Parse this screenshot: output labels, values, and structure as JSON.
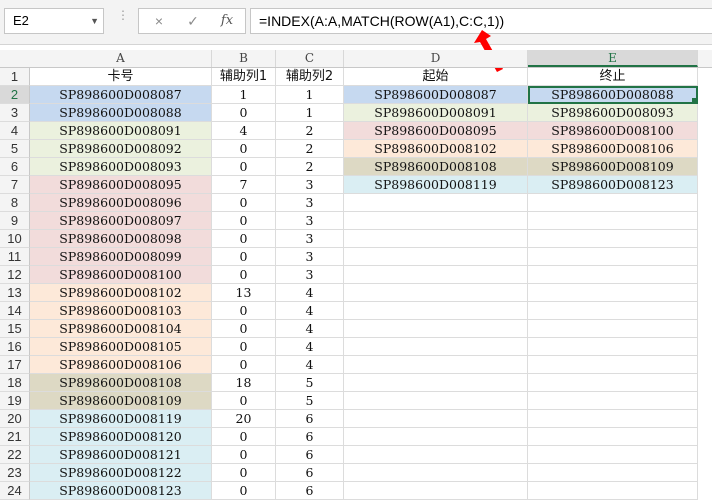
{
  "formula_bar": {
    "name_box": "E2",
    "cancel_icon": "×",
    "confirm_icon": "✓",
    "fx_label": "fx",
    "formula": "=INDEX(A:A,MATCH(ROW(A1),C:C,1))"
  },
  "colors": {
    "blue": "#c6d9f0",
    "green": "#ebf1de",
    "pink": "#f2dcdb",
    "peach": "#fde9d9",
    "tan": "#ddd9c4",
    "cyan": "#daeef3",
    "arrow": "#ff0000",
    "select": "#217346"
  },
  "columns": [
    "A",
    "B",
    "C",
    "D",
    "E"
  ],
  "selected_cell": "E2",
  "rows": [
    {
      "n": "1",
      "a": "卡号",
      "b": "辅助列1",
      "c": "辅助列2",
      "d": "起始",
      "e": "终止",
      "fill": "",
      "fill_de": ""
    },
    {
      "n": "2",
      "a": "SP898600D008087",
      "b": "1",
      "c": "1",
      "d": "SP898600D008087",
      "e": "SP898600D008088",
      "fill": "blue",
      "fill_de": "blue"
    },
    {
      "n": "3",
      "a": "SP898600D008088",
      "b": "0",
      "c": "1",
      "d": "SP898600D008091",
      "e": "SP898600D008093",
      "fill": "blue",
      "fill_de": "green"
    },
    {
      "n": "4",
      "a": "SP898600D008091",
      "b": "4",
      "c": "2",
      "d": "SP898600D008095",
      "e": "SP898600D008100",
      "fill": "green",
      "fill_de": "pink"
    },
    {
      "n": "5",
      "a": "SP898600D008092",
      "b": "0",
      "c": "2",
      "d": "SP898600D008102",
      "e": "SP898600D008106",
      "fill": "green",
      "fill_de": "peach"
    },
    {
      "n": "6",
      "a": "SP898600D008093",
      "b": "0",
      "c": "2",
      "d": "SP898600D008108",
      "e": "SP898600D008109",
      "fill": "green",
      "fill_de": "tan"
    },
    {
      "n": "7",
      "a": "SP898600D008095",
      "b": "7",
      "c": "3",
      "d": "SP898600D008119",
      "e": "SP898600D008123",
      "fill": "pink",
      "fill_de": "cyan"
    },
    {
      "n": "8",
      "a": "SP898600D008096",
      "b": "0",
      "c": "3",
      "d": "",
      "e": "",
      "fill": "pink",
      "fill_de": ""
    },
    {
      "n": "9",
      "a": "SP898600D008097",
      "b": "0",
      "c": "3",
      "d": "",
      "e": "",
      "fill": "pink",
      "fill_de": ""
    },
    {
      "n": "10",
      "a": "SP898600D008098",
      "b": "0",
      "c": "3",
      "d": "",
      "e": "",
      "fill": "pink",
      "fill_de": ""
    },
    {
      "n": "11",
      "a": "SP898600D008099",
      "b": "0",
      "c": "3",
      "d": "",
      "e": "",
      "fill": "pink",
      "fill_de": ""
    },
    {
      "n": "12",
      "a": "SP898600D008100",
      "b": "0",
      "c": "3",
      "d": "",
      "e": "",
      "fill": "pink",
      "fill_de": ""
    },
    {
      "n": "13",
      "a": "SP898600D008102",
      "b": "13",
      "c": "4",
      "d": "",
      "e": "",
      "fill": "peach",
      "fill_de": ""
    },
    {
      "n": "14",
      "a": "SP898600D008103",
      "b": "0",
      "c": "4",
      "d": "",
      "e": "",
      "fill": "peach",
      "fill_de": ""
    },
    {
      "n": "15",
      "a": "SP898600D008104",
      "b": "0",
      "c": "4",
      "d": "",
      "e": "",
      "fill": "peach",
      "fill_de": ""
    },
    {
      "n": "16",
      "a": "SP898600D008105",
      "b": "0",
      "c": "4",
      "d": "",
      "e": "",
      "fill": "peach",
      "fill_de": ""
    },
    {
      "n": "17",
      "a": "SP898600D008106",
      "b": "0",
      "c": "4",
      "d": "",
      "e": "",
      "fill": "peach",
      "fill_de": ""
    },
    {
      "n": "18",
      "a": "SP898600D008108",
      "b": "18",
      "c": "5",
      "d": "",
      "e": "",
      "fill": "tan",
      "fill_de": ""
    },
    {
      "n": "19",
      "a": "SP898600D008109",
      "b": "0",
      "c": "5",
      "d": "",
      "e": "",
      "fill": "tan",
      "fill_de": ""
    },
    {
      "n": "20",
      "a": "SP898600D008119",
      "b": "20",
      "c": "6",
      "d": "",
      "e": "",
      "fill": "cyan",
      "fill_de": ""
    },
    {
      "n": "21",
      "a": "SP898600D008120",
      "b": "0",
      "c": "6",
      "d": "",
      "e": "",
      "fill": "cyan",
      "fill_de": ""
    },
    {
      "n": "22",
      "a": "SP898600D008121",
      "b": "0",
      "c": "6",
      "d": "",
      "e": "",
      "fill": "cyan",
      "fill_de": ""
    },
    {
      "n": "23",
      "a": "SP898600D008122",
      "b": "0",
      "c": "6",
      "d": "",
      "e": "",
      "fill": "cyan",
      "fill_de": ""
    },
    {
      "n": "24",
      "a": "SP898600D008123",
      "b": "0",
      "c": "6",
      "d": "",
      "e": "",
      "fill": "cyan",
      "fill_de": ""
    }
  ]
}
